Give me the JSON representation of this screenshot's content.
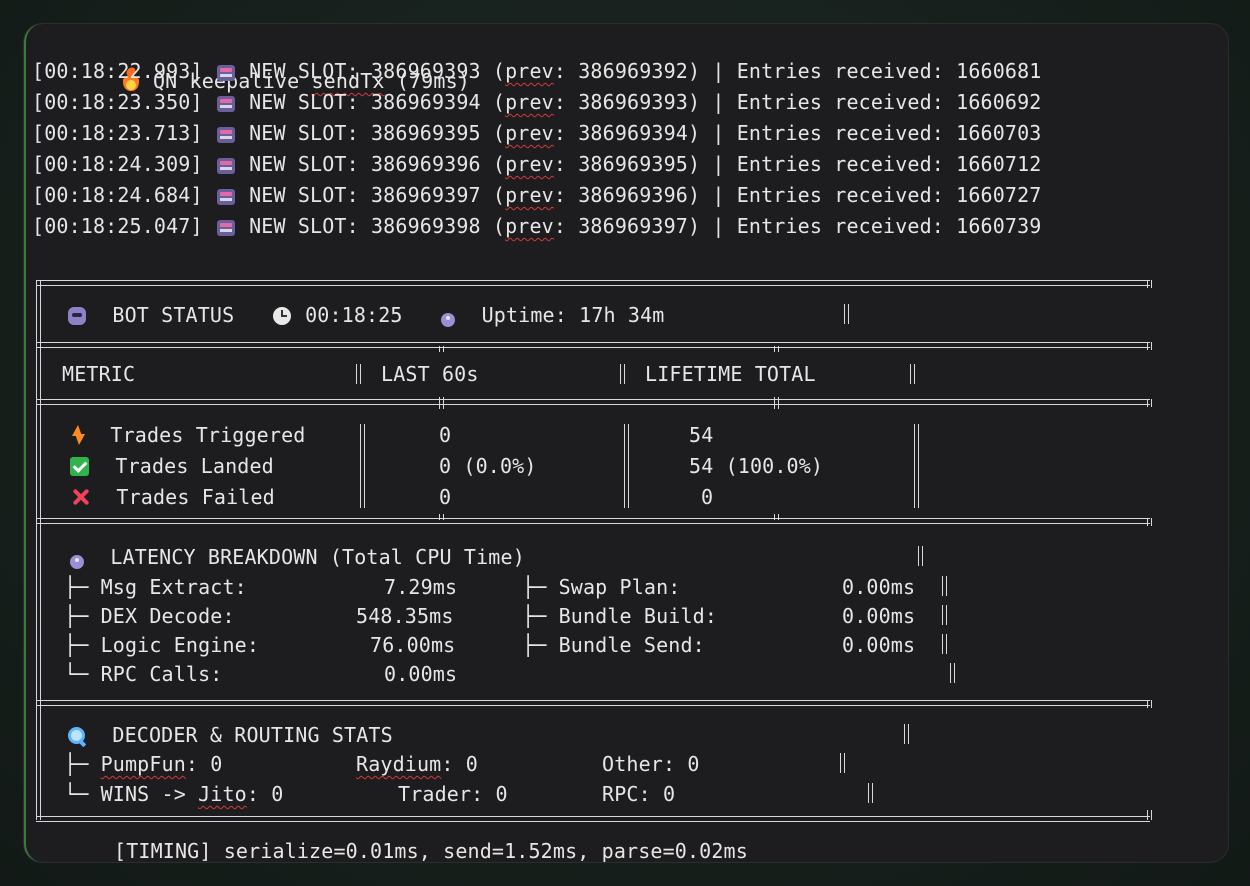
{
  "keepalive": {
    "prefix": "QN keepalive ",
    "method": "sendTx",
    "duration": " (79ms)"
  },
  "slots": [
    {
      "time": "[00:18:22.993]",
      "label": " NEW SLOT: 386969393 (",
      "prev_word": "prev",
      "rest": ": 386969392) | Entries received: 1660681"
    },
    {
      "time": "[00:18:23.350]",
      "label": " NEW SLOT: 386969394 (",
      "prev_word": "prev",
      "rest": ": 386969393) | Entries received: 1660692"
    },
    {
      "time": "[00:18:23.713]",
      "label": " NEW SLOT: 386969395 (",
      "prev_word": "prev",
      "rest": ": 386969394) | Entries received: 1660703"
    },
    {
      "time": "[00:18:24.309]",
      "label": " NEW SLOT: 386969396 (",
      "prev_word": "prev",
      "rest": ": 386969395) | Entries received: 1660712"
    },
    {
      "time": "[00:18:24.684]",
      "label": " NEW SLOT: 386969397 (",
      "prev_word": "prev",
      "rest": ": 386969396) | Entries received: 1660727"
    },
    {
      "time": "[00:18:25.047]",
      "label": " NEW SLOT: 386969398 (",
      "prev_word": "prev",
      "rest": ": 386969397) | Entries received: 1660739"
    }
  ],
  "status": {
    "title": "BOT STATUS",
    "clock": "00:18:25",
    "uptime": "Uptime: 17h 34m"
  },
  "metrics_header": {
    "metric": "METRIC",
    "last": "LAST 60s",
    "lifetime": "LIFETIME TOTAL"
  },
  "metrics": [
    {
      "icon": "bolt-icon",
      "name": "Trades Triggered",
      "last": "0",
      "lifetime": "54"
    },
    {
      "icon": "check-icon",
      "name": "Trades Landed",
      "last": "0 (0.0%)",
      "lifetime": "54 (100.0%)"
    },
    {
      "icon": "cross-icon",
      "name": "Trades Failed",
      "last": "0",
      "lifetime": "0"
    }
  ],
  "latency": {
    "title": "LATENCY BREAKDOWN (Total CPU Time)",
    "rows": [
      {
        "left_label": "├─ Msg Extract:",
        "left_value": "7.29ms",
        "right_label": "├─ Swap Plan:",
        "right_value": "0.00ms"
      },
      {
        "left_label": "├─ DEX Decode:",
        "left_value": "548.35ms",
        "right_label": "├─ Bundle Build:",
        "right_value": "0.00ms"
      },
      {
        "left_label": "├─ Logic Engine:",
        "left_value": "76.00ms",
        "right_label": "├─ Bundle Send:",
        "right_value": "0.00ms"
      },
      {
        "left_label": "└─ RPC Calls:",
        "left_value": "0.00ms"
      }
    ]
  },
  "decoder": {
    "title": "DECODER & ROUTING STATS",
    "row1": {
      "branch": "├─ ",
      "pumpfun_word": "PumpFun",
      "pumpfun_rest": ": 0",
      "raydium_word": "Raydium",
      "raydium_rest": ": 0",
      "other": "Other: 0"
    },
    "row2": {
      "branch": "└─ WINS -> ",
      "jito_word": "Jito",
      "jito_rest": ": 0",
      "trader": "Trader: 0",
      "rpc": "RPC: 0"
    }
  },
  "timing": "[TIMING] serialize=0.01ms, send=1.52ms, parse=0.02ms",
  "colors": {
    "background": "#1d1d1f",
    "text": "#e6e6e6",
    "spellcheck": "#d23a3a",
    "border": "#d8d8d8"
  }
}
